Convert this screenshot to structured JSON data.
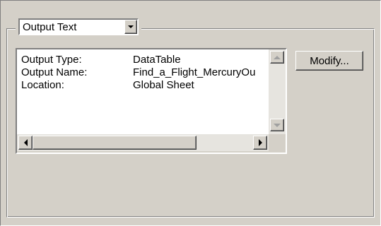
{
  "dropdown": {
    "selected": "Output Text"
  },
  "properties": [
    {
      "key": "Output Type:",
      "value": "DataTable"
    },
    {
      "key": "Output Name:",
      "value": "Find_a_Flight_MercuryOu"
    },
    {
      "key": "Location:",
      "value": "Global Sheet"
    }
  ],
  "buttons": {
    "modify": "Modify..."
  },
  "colors": {
    "face": "#d4d0c8",
    "shadow": "#808080",
    "highlight": "#ffffff"
  },
  "icons": {
    "dropdown": "chevron-down-icon",
    "scroll_up": "scroll-up-arrow-icon",
    "scroll_down": "scroll-down-arrow-icon",
    "scroll_left": "scroll-left-arrow-icon",
    "scroll_right": "scroll-right-arrow-icon"
  }
}
